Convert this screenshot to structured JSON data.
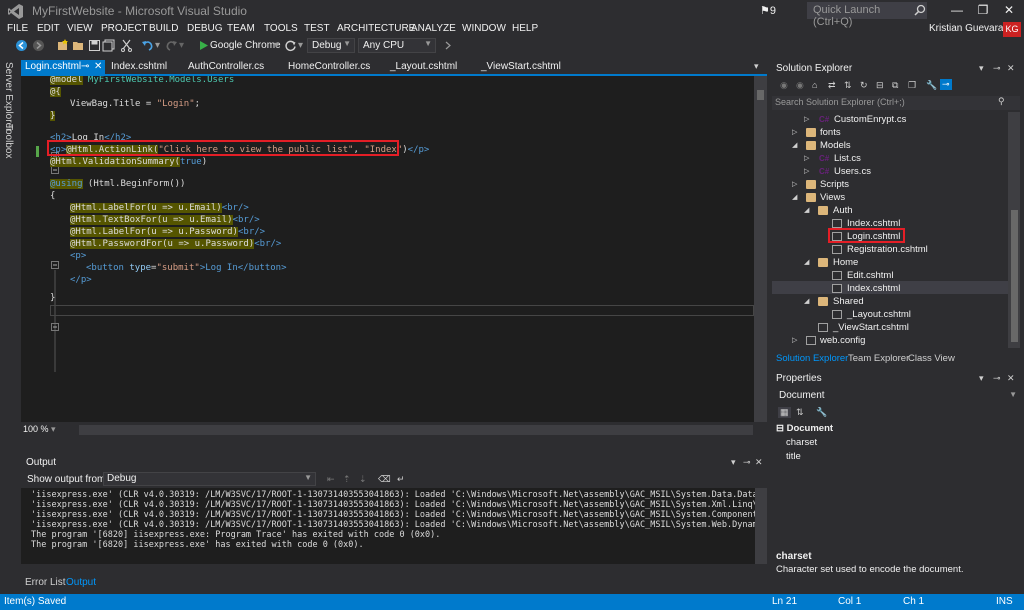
{
  "window": {
    "title": "MyFirstWebsite - Microsoft Visual Studio",
    "notifications": "9",
    "quick_launch_placeholder": "Quick Launch (Ctrl+Q)",
    "user_name": "Kristian Guevara",
    "user_initials": "KG",
    "minimize": "—",
    "restore": "❐",
    "close": "✕"
  },
  "menu": [
    "FILE",
    "EDIT",
    "VIEW",
    "PROJECT",
    "BUILD",
    "DEBUG",
    "TEAM",
    "TOOLS",
    "TEST",
    "ARCHITECTURE",
    "ANALYZE",
    "WINDOW",
    "HELP"
  ],
  "toolbar": {
    "browser": "Google Chrome",
    "configuration": "Debug",
    "platform": "Any CPU"
  },
  "left_strip": [
    "Server Explorer",
    "Toolbox"
  ],
  "editor_tabs": [
    {
      "label": "Login.cshtml",
      "active": true
    },
    {
      "label": "Index.cshtml",
      "active": false
    },
    {
      "label": "AuthController.cs",
      "active": false
    },
    {
      "label": "HomeController.cs",
      "active": false
    },
    {
      "label": "_Layout.cshtml",
      "active": false
    },
    {
      "label": "_ViewStart.cshtml",
      "active": false
    }
  ],
  "code": {
    "l1_razor": "@model",
    "l1_type": " MyFirstWebsite.Models.Users",
    "l2": "@{",
    "l3a": "ViewBag.Title = ",
    "l3b": "\"Login\"",
    "l3c": ";",
    "l4": "}",
    "l5a": "<h2>",
    "l5b": "Log In",
    "l5c": "</h2>",
    "l6a": "<p>",
    "l6b": "@Html.ActionLink(",
    "l6c": "\"Click here to view the public list\"",
    "l6d": ", ",
    "l6e": "\"Index\"",
    "l6f": ")",
    "l6g": "</p>",
    "l7a": "@Html.ValidationSummary(",
    "l7b": "true",
    "l7c": ")",
    "l8a": "@using",
    "l8b": " (Html.BeginForm())",
    "l9": "{",
    "l10a": "@Html.LabelFor(u => u.Email)",
    "l10b": "<br/>",
    "l11a": "@Html.TextBoxFor(u => u.Email)",
    "l11b": "<br/>",
    "l12a": "@Html.LabelFor(u => u.Password)",
    "l12b": "<br/>",
    "l13a": "@Html.PasswordFor(u => u.Password)",
    "l13b": "<br/>",
    "l14": "<p>",
    "l15a": "<button",
    "l15b": " type",
    "l15c": "=",
    "l15d": "\"submit\"",
    "l15e": ">Log In</button>",
    "l16": "</p>",
    "l17": "}"
  },
  "editor_zoom": "100 %",
  "output": {
    "title": "Output",
    "show_from_label": "Show output from:",
    "source": "Debug",
    "lines": [
      "'iisexpress.exe' (CLR v4.0.30319: /LM/W3SVC/17/ROOT-1-130731403553041863): Loaded 'C:\\Windows\\Microsoft.Net\\assembly\\GAC_MSIL\\System.Data.DataSetE",
      "'iisexpress.exe' (CLR v4.0.30319: /LM/W3SVC/17/ROOT-1-130731403553041863): Loaded 'C:\\Windows\\Microsoft.Net\\assembly\\GAC_MSIL\\System.Xml.Linq\\v4.0",
      "'iisexpress.exe' (CLR v4.0.30319: /LM/W3SVC/17/ROOT-1-130731403553041863): Loaded 'C:\\Windows\\Microsoft.Net\\assembly\\GAC_MSIL\\System.ComponentModel",
      "'iisexpress.exe' (CLR v4.0.30319: /LM/W3SVC/17/ROOT-1-130731403553041863): Loaded 'C:\\Windows\\Microsoft.Net\\assembly\\GAC_MSIL\\System.Web.DynamicDa",
      "The program '[6820] iisexpress.exe: Program Trace' has exited with code 0 (0x0).",
      "The program '[6820] iisexpress.exe' has exited with code 0 (0x0)."
    ]
  },
  "bottom_tabs": [
    {
      "label": "Error List",
      "active": false
    },
    {
      "label": "Output",
      "active": true
    }
  ],
  "solution_explorer": {
    "title": "Solution Explorer",
    "search_placeholder": "Search Solution Explorer (Ctrl+;)",
    "tree": [
      {
        "label": "CustomEnrypt.cs",
        "kind": "cs",
        "twisty": "▷"
      },
      {
        "label": "fonts",
        "kind": "folder",
        "twisty": "▷"
      },
      {
        "label": "Models",
        "kind": "folder",
        "twisty": "◢"
      },
      {
        "label": "List.cs",
        "kind": "cs",
        "twisty": "▷"
      },
      {
        "label": "Users.cs",
        "kind": "cs",
        "twisty": "▷"
      },
      {
        "label": "Scripts",
        "kind": "folder",
        "twisty": "▷"
      },
      {
        "label": "Views",
        "kind": "folder",
        "twisty": "◢"
      },
      {
        "label": "Auth",
        "kind": "folder",
        "twisty": "◢"
      },
      {
        "label": "Index.cshtml",
        "kind": "html",
        "twisty": ""
      },
      {
        "label": "Login.cshtml",
        "kind": "html",
        "twisty": ""
      },
      {
        "label": "Registration.cshtml",
        "kind": "html",
        "twisty": ""
      },
      {
        "label": "Home",
        "kind": "folder",
        "twisty": "◢"
      },
      {
        "label": "Edit.cshtml",
        "kind": "html",
        "twisty": ""
      },
      {
        "label": "Index.cshtml",
        "kind": "html",
        "twisty": ""
      },
      {
        "label": "Shared",
        "kind": "folder",
        "twisty": "◢"
      },
      {
        "label": "_Layout.cshtml",
        "kind": "html",
        "twisty": ""
      },
      {
        "label": "_ViewStart.cshtml",
        "kind": "html",
        "twisty": ""
      },
      {
        "label": "web.config",
        "kind": "cfg",
        "twisty": "▷"
      }
    ],
    "tabs": [
      {
        "label": "Solution Explorer",
        "active": true
      },
      {
        "label": "Team Explorer",
        "active": false
      },
      {
        "label": "Class View",
        "active": false
      }
    ]
  },
  "properties": {
    "title": "Properties",
    "object": "Document",
    "category": "Document",
    "rows": [
      "charset",
      "title"
    ],
    "desc_name": "charset",
    "desc_text": "Character set used to encode the document."
  },
  "status": {
    "message": "Item(s) Saved",
    "line": "Ln 21",
    "col": "Col 1",
    "ch": "Ch 1",
    "mode": "INS"
  },
  "colors": {
    "accent": "#007acc",
    "highlight_box": "#e41e26",
    "background": "#2d2d30",
    "editor_bg": "#1e1e1e"
  }
}
